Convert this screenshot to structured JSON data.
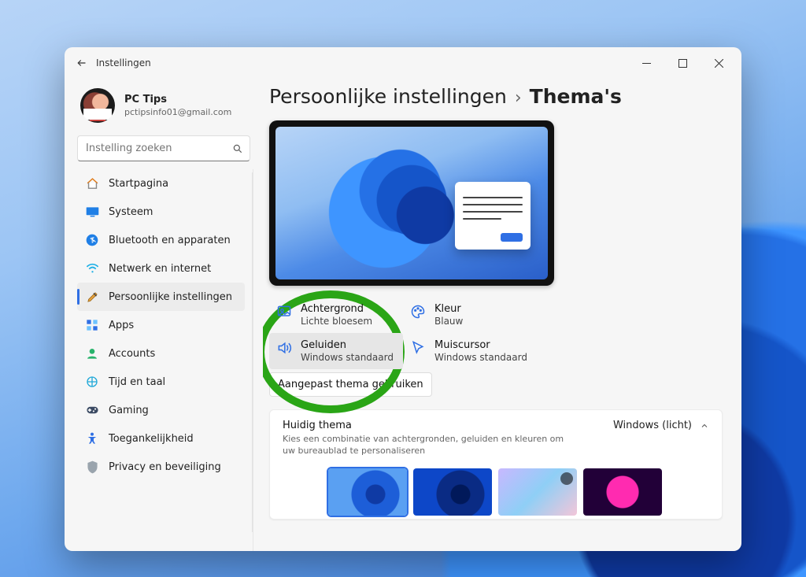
{
  "window_title": "Instellingen",
  "profile": {
    "name": "PC Tips",
    "email": "pctipsinfo01@gmail.com"
  },
  "search": {
    "placeholder": "Instelling zoeken"
  },
  "sidebar": {
    "items": [
      {
        "label": "Startpagina"
      },
      {
        "label": "Systeem"
      },
      {
        "label": "Bluetooth en apparaten"
      },
      {
        "label": "Netwerk en internet"
      },
      {
        "label": "Persoonlijke instellingen"
      },
      {
        "label": "Apps"
      },
      {
        "label": "Accounts"
      },
      {
        "label": "Tijd en taal"
      },
      {
        "label": "Gaming"
      },
      {
        "label": "Toegankelijkheid"
      },
      {
        "label": "Privacy en beveiliging"
      }
    ],
    "active_index": 4
  },
  "breadcrumb": {
    "parent": "Persoonlijke instellingen",
    "current": "Thema's"
  },
  "theme_options": {
    "background": {
      "title": "Achtergrond",
      "value": "Lichte bloesem"
    },
    "color": {
      "title": "Kleur",
      "value": "Blauw"
    },
    "sounds": {
      "title": "Geluiden",
      "value": "Windows standaard"
    },
    "cursor": {
      "title": "Muiscursor",
      "value": "Windows standaard"
    },
    "apply_label": "Aangepast thema gebruiken"
  },
  "current_theme": {
    "title": "Huidig thema",
    "subtitle": "Kies een combinatie van achtergronden, geluiden en kleuren om uw bureaublad te personaliseren",
    "selected": "Windows (licht)"
  },
  "colors": {
    "accent": "#2f6fe4",
    "highlight_ring": "#2aa516"
  }
}
